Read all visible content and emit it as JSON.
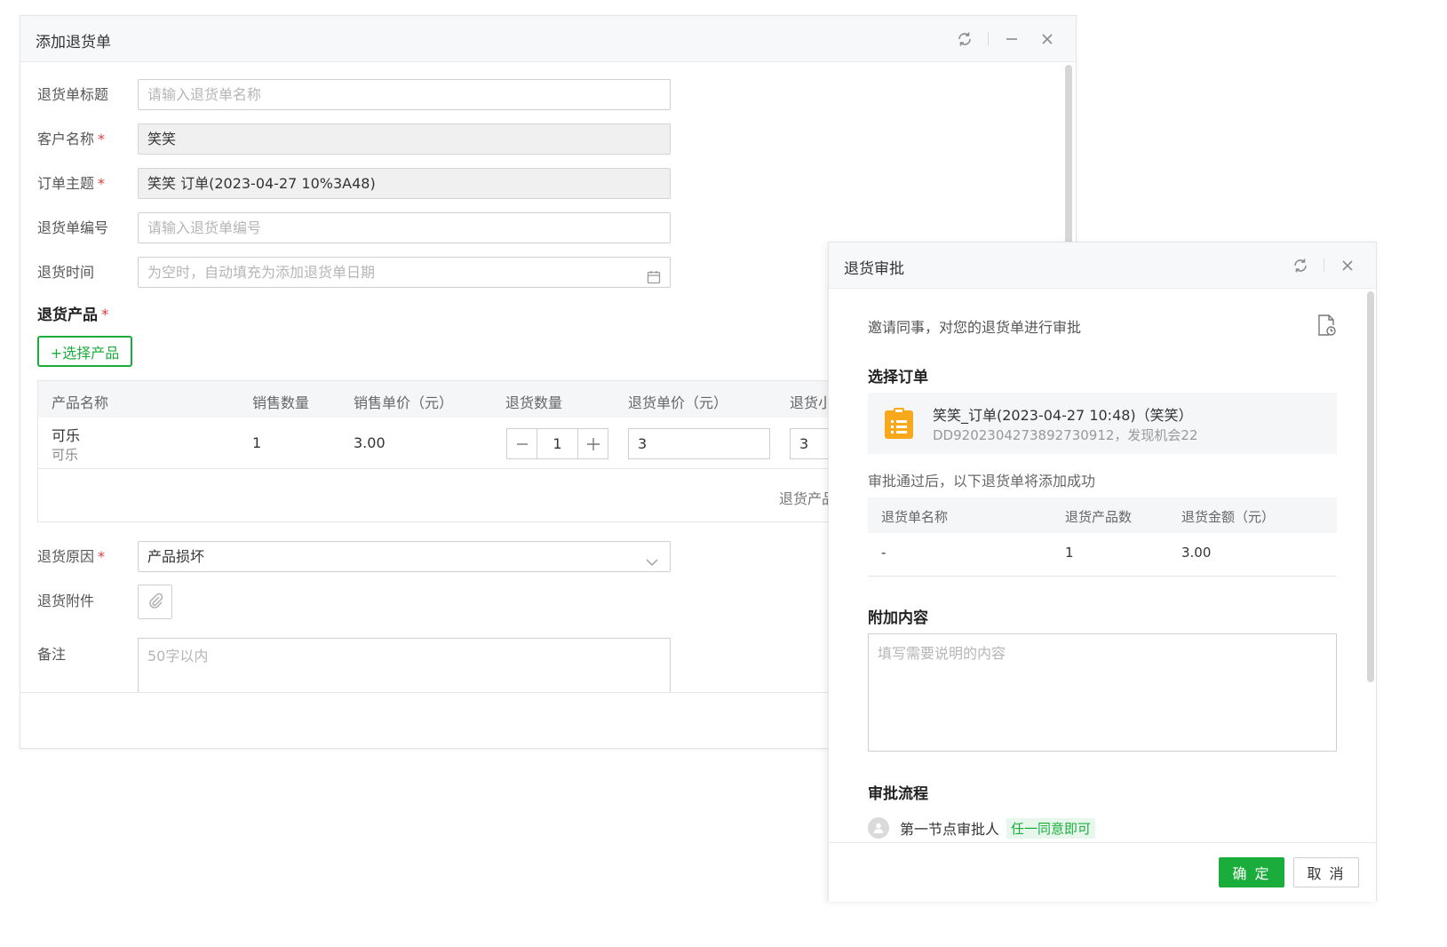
{
  "main": {
    "title": "添加退货单",
    "fields": {
      "title_label": "退货单标题",
      "title_placeholder": "请输入退货单名称",
      "customer_label": "客户名称",
      "customer_value": "笑笑",
      "order_label": "订单主题",
      "order_value": "笑笑 订单(2023-04-27 10%3A48)",
      "number_label": "退货单编号",
      "number_placeholder": "请输入退货单编号",
      "time_label": "退货时间",
      "time_placeholder": "为空时，自动填充为添加退货单日期",
      "reason_label": "退货原因",
      "reason_value": "产品损坏",
      "attach_label": "退货附件",
      "remark_label": "备注",
      "remark_placeholder": "50字以内",
      "required_mark": "*"
    },
    "products": {
      "section_label": "退货产品",
      "select_button": "+选择产品",
      "columns": [
        "产品名称",
        "销售数量",
        "销售单价（元）",
        "退货数量",
        "退货单价（元）",
        "退货小"
      ],
      "rows": [
        {
          "name": "可乐",
          "sub": "可乐",
          "sale_qty": "1",
          "sale_price": "3.00",
          "return_qty": "1",
          "return_price": "3",
          "subtotal": "3"
        }
      ],
      "summary": "退货产品"
    }
  },
  "approval": {
    "title": "退货审批",
    "invite_text": "邀请同事，对您的退货单进行审批",
    "order_heading": "选择订单",
    "order_name": "笑笑_订单(2023-04-27 10:48)（笑笑）",
    "order_code": "DD9202304273892730912，发现机会22",
    "note": "审批通过后，以下退货单将添加成功",
    "table_columns": [
      "退货单名称",
      "退货产品数",
      "退货金额（元）"
    ],
    "table_row": [
      "-",
      "1",
      "3.00"
    ],
    "extra_heading": "附加内容",
    "extra_placeholder": "填写需要说明的内容",
    "flow_heading": "审批流程",
    "flow_node": "第一节点审批人",
    "flow_tag": "任一同意即可",
    "ok_button": "确 定",
    "cancel_button": "取 消"
  },
  "colors": {
    "accent": "#1aad3c",
    "required": "#e23c3c",
    "order_icon": "#f7a81b"
  },
  "icons": [
    "refresh-icon",
    "minimize-icon",
    "close-icon",
    "calendar-icon",
    "chevron-down-icon",
    "paperclip-icon",
    "document-clock-icon",
    "order-list-icon",
    "user-avatar-icon"
  ]
}
